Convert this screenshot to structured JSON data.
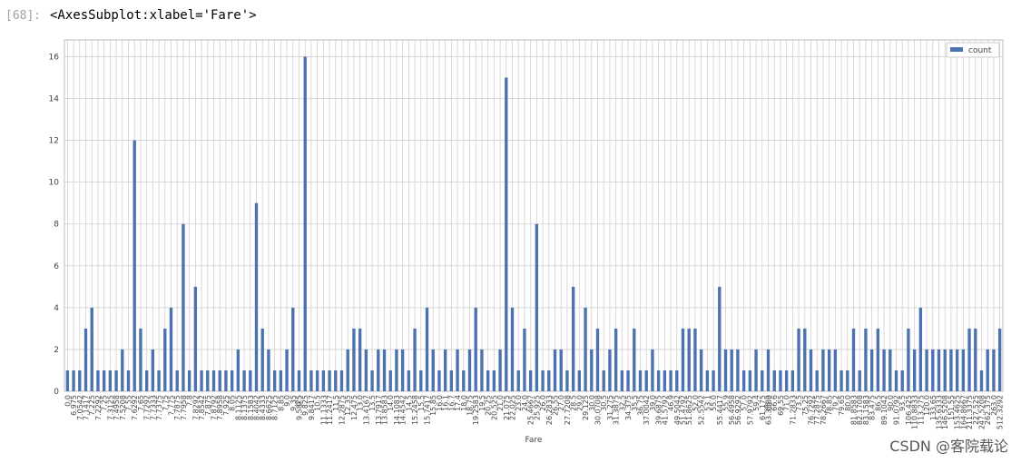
{
  "cell": {
    "prompt": "[68]:",
    "output_text": "<AxesSubplot:xlabel='Fare'>"
  },
  "watermark": "CSDN @客院载论",
  "colors": {
    "bar": "#4c72b0",
    "grid": "#d0d0d0",
    "frame": "#bdbdbd",
    "text": "#444444"
  },
  "chart_data": {
    "type": "bar",
    "xlabel": "Fare",
    "ylabel": "",
    "ylim": [
      0,
      16.8
    ],
    "yticks": [
      0,
      2,
      4,
      6,
      8,
      10,
      12,
      14,
      16
    ],
    "grid": true,
    "legend_position": "top-right",
    "series": [
      {
        "name": "count",
        "values": [
          1,
          1,
          1,
          3,
          4,
          1,
          1,
          1,
          1,
          2,
          1,
          12,
          3,
          1,
          2,
          1,
          3,
          4,
          1,
          8,
          1,
          5,
          1,
          1,
          1,
          1,
          1,
          1,
          2,
          1,
          1,
          9,
          3,
          2,
          1,
          1,
          2,
          4,
          1,
          16,
          1,
          1,
          1,
          1,
          1,
          1,
          2,
          3,
          3,
          2,
          1,
          2,
          2,
          1,
          2,
          2,
          1,
          3,
          1,
          4,
          2,
          1,
          2,
          1,
          2,
          1,
          2,
          4,
          2,
          1,
          1,
          2,
          15,
          4,
          1,
          3,
          1,
          8,
          1,
          1,
          2,
          2,
          1,
          5,
          1,
          4,
          2,
          3,
          1,
          2,
          3,
          1,
          1,
          3,
          1,
          1,
          2,
          1,
          1,
          1,
          1,
          3,
          3,
          3,
          2,
          1,
          1,
          5,
          2,
          2,
          2,
          1,
          1,
          2,
          1,
          2,
          1,
          1,
          1,
          1,
          3,
          3,
          2,
          1,
          2,
          2,
          2,
          1,
          1,
          3,
          1,
          3,
          2,
          3,
          2,
          2,
          1,
          1,
          3,
          2,
          4,
          2,
          2,
          2,
          2,
          2,
          2,
          2,
          3,
          3,
          1,
          2,
          2,
          3
        ]
      }
    ],
    "visible_tick_labels": [
      "0.0",
      "6.975",
      "7.0542",
      "7.1417",
      "7.225",
      "7.2292",
      "7.25",
      "7.3125",
      "7.4958",
      "7.5208",
      "7.55",
      "7.6292",
      "7.65",
      "7.7292",
      "7.7333",
      "7.7375",
      "7.75",
      "7.775",
      "7.7875",
      "7.7958",
      "7.8",
      "7.8292",
      "7.8542",
      "7.875",
      "7.8792",
      "7.8958",
      "7.925",
      "8.05",
      "8.1125",
      "8.1375",
      "8.1583",
      "8.4042",
      "8.4333",
      "8.6625",
      "8.7125",
      "8.85",
      "9.0",
      "9.35",
      "9.5",
      "9.5875",
      "9.825",
      "9.8417",
      "10.5",
      "11.1333",
      "11.2417",
      "11.5",
      "12.2875",
      "12.35",
      "12.475",
      "13.0",
      "13.4167",
      "13.5",
      "13.7917",
      "13.8583",
      "14.0",
      "14.1083",
      "14.4542",
      "14.5",
      "15.2458",
      "15.5",
      "15.7417",
      "15.85",
      "16.0",
      "16.1",
      "16.7",
      "17.4",
      "18.0",
      "18.75",
      "19.2583",
      "19.5",
      "20.25",
      "20.525",
      "21.0",
      "21.075",
      "22.025",
      "23.0",
      "24.0",
      "25.4667",
      "25.925",
      "26.0",
      "26.2833",
      "26.55",
      "27.0",
      "27.7208",
      "28.5",
      "29.0",
      "29.125",
      "30.0",
      "30.0708",
      "30.5",
      "31.275",
      "31.3875",
      "32.5",
      "34.375",
      "35.5",
      "36.75",
      "37.0042",
      "39.0",
      "39.6875",
      "41.5792",
      "46.9",
      "49.5042",
      "51.4792",
      "51.8625",
      "52.0",
      "52.5542",
      "53.1",
      "55.0",
      "55.4417",
      "55.9",
      "56.4958",
      "56.9292",
      "57.0",
      "57.9792",
      "59.4",
      "61.175",
      "63.3583",
      "65.0",
      "66.6",
      "69.55",
      "71.0",
      "71.2833",
      "73.5",
      "75.25",
      "76.7292",
      "77.2875",
      "78.2667",
      "78.85",
      "79.2",
      "79.65",
      "80.0",
      "81.8583",
      "82.1708",
      "83.1583",
      "83.475",
      "86.5",
      "89.1042",
      "90.0",
      "91.0792",
      "93.5",
      "106.425",
      "110.8833",
      "113.275",
      "120.0",
      "133.65",
      "135.6333",
      "146.5208",
      "151.55",
      "153.4625",
      "164.8667",
      "211.3375",
      "227.525",
      "247.5208",
      "262.375",
      "263.0",
      "512.3292"
    ]
  }
}
